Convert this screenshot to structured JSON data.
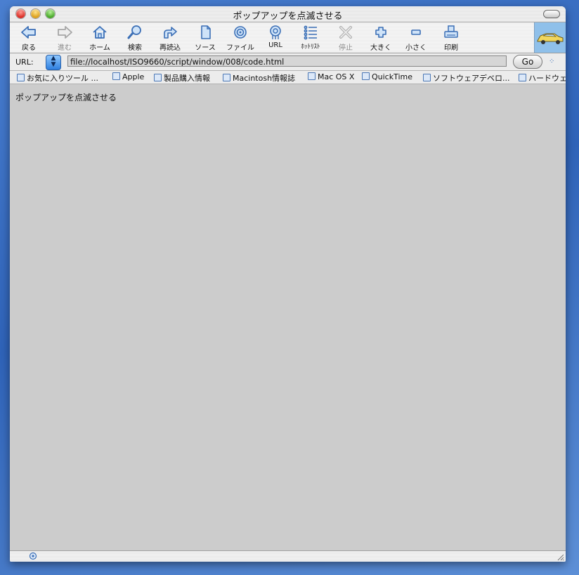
{
  "window": {
    "title": "ポップアップを点滅させる"
  },
  "toolbar": {
    "buttons": [
      {
        "id": "back",
        "label": "戻る",
        "icon": "back-arrow-icon",
        "enabled": true
      },
      {
        "id": "forward",
        "label": "進む",
        "icon": "forward-arrow-icon",
        "enabled": false
      },
      {
        "id": "home",
        "label": "ホーム",
        "icon": "home-icon",
        "enabled": true
      },
      {
        "id": "search",
        "label": "検索",
        "icon": "search-icon",
        "enabled": true
      },
      {
        "id": "reload",
        "label": "再読込",
        "icon": "reload-icon",
        "enabled": true
      },
      {
        "id": "source",
        "label": "ソース",
        "icon": "document-icon",
        "enabled": true
      },
      {
        "id": "file",
        "label": "ファイル",
        "icon": "target-icon",
        "enabled": true
      },
      {
        "id": "url",
        "label": "URL",
        "icon": "url-globe-icon",
        "enabled": true
      },
      {
        "id": "hotlist",
        "label": "ﾎｯﾄﾘｽﾄ",
        "icon": "list-icon",
        "enabled": true
      },
      {
        "id": "stop",
        "label": "停止",
        "icon": "stop-x-icon",
        "enabled": false
      },
      {
        "id": "bigger",
        "label": "大きく",
        "icon": "plus-icon",
        "enabled": true
      },
      {
        "id": "smaller",
        "label": "小さく",
        "icon": "minus-icon",
        "enabled": true
      },
      {
        "id": "print",
        "label": "印刷",
        "icon": "printer-icon",
        "enabled": true
      }
    ]
  },
  "urlbar": {
    "label": "URL:",
    "value": "file://localhost/ISO9660/script/window/008/code.html",
    "go_label": "Go"
  },
  "favorites": [
    "お気に入りツール ...",
    "Apple",
    "製品購入情報",
    "Macintosh情報誌",
    "Mac OS X",
    "QuickTime",
    "ソフトウェアデベロ...",
    "ハードウェ"
  ],
  "content": {
    "text": "ポップアップを点滅させる"
  },
  "colors": {
    "accent": "#3b6fb6",
    "content_bg": "#cccccc"
  }
}
